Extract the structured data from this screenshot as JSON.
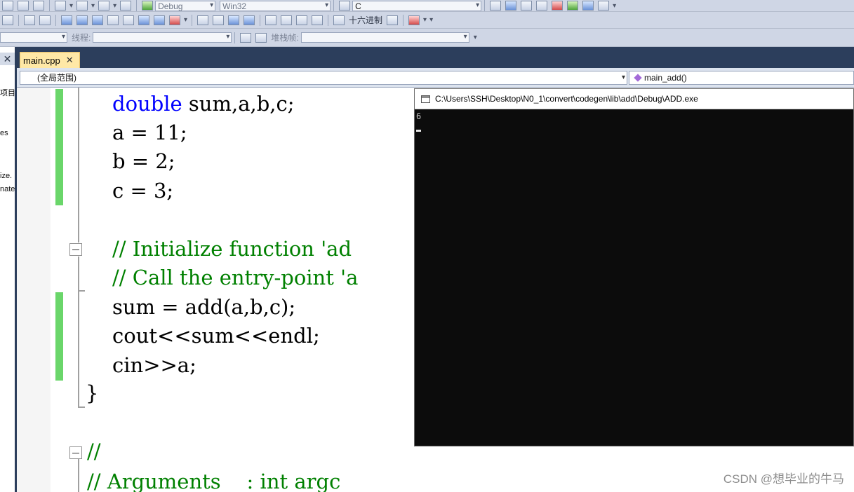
{
  "toolbar": {
    "config_combo": "Debug",
    "platform_combo": "Win32",
    "search_combo": "C",
    "hex_label": "十六进制",
    "thread_label": "线程:",
    "stackframe_label": "堆栈帧:"
  },
  "side_panel": {
    "fragments": [
      "项目",
      "es",
      "ize.",
      "nate"
    ]
  },
  "tabs": [
    {
      "label": "main.cpp",
      "active": true
    }
  ],
  "nav": {
    "scope": "(全局范围)",
    "function": "main_add()"
  },
  "code": {
    "line1_kw": "double",
    "line1_rest": " sum,a,b,c;",
    "line2": "a = 11;",
    "line3": "b = 2;",
    "line4": "c = 3;",
    "line5": "// Initialize function 'ad",
    "line6": "// Call the entry-point 'a",
    "line7": "sum = add(a,b,c);",
    "line8": "cout<<sum<<endl;",
    "line9": "cin>>a;",
    "line10": "}",
    "line11": "//",
    "line12": "// Arguments    : int argc"
  },
  "console": {
    "title": "C:\\Users\\SSH\\Desktop\\N0_1\\convert\\codegen\\lib\\add\\Debug\\ADD.exe",
    "output": "6"
  },
  "watermark": "CSDN @想毕业的牛马",
  "colors": {
    "keyword": "#0000ff",
    "comment": "#008000",
    "change_bar": "#6ad66a",
    "tab_active": "#ffe8a6",
    "tabstrip": "#2c3e5c"
  }
}
